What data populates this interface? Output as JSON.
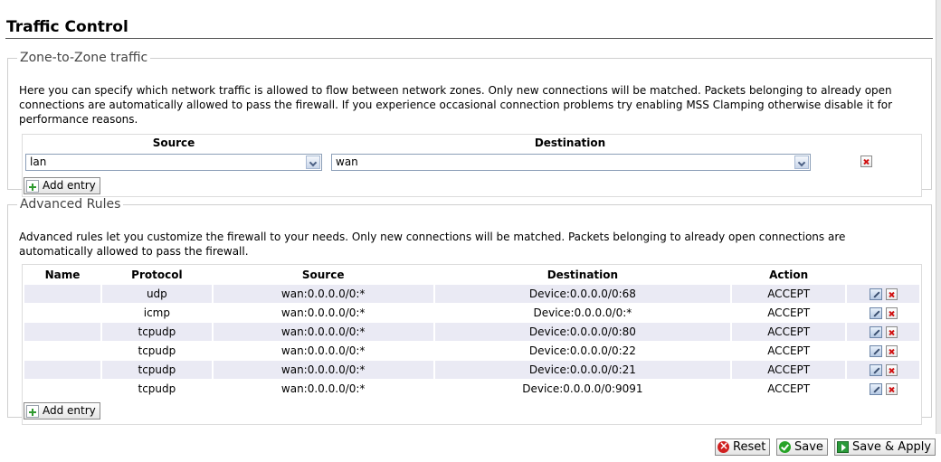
{
  "page": {
    "title": "Traffic Control"
  },
  "zone_to_zone": {
    "legend": "Zone-to-Zone traffic",
    "description": "Here you can specify which network traffic is allowed to flow between network zones. Only new connections will be matched. Packets belonging to already open connections are automatically allowed to pass the firewall. If you experience occasional connection problems try enabling MSS Clamping otherwise disable it for performance reasons.",
    "columns": {
      "source": "Source",
      "destination": "Destination"
    },
    "row": {
      "source_value": "lan",
      "destination_value": "wan"
    },
    "add_entry_label": "Add entry"
  },
  "advanced": {
    "legend": "Advanced Rules",
    "description": "Advanced rules let you customize the firewall to your needs. Only new connections will be matched. Packets belonging to already open connections are automatically allowed to pass the firewall.",
    "columns": [
      "Name",
      "Protocol",
      "Source",
      "Destination",
      "Action"
    ],
    "rows": [
      {
        "name": "",
        "protocol": "udp",
        "source": "wan:0.0.0.0/0:*",
        "destination": "Device:0.0.0.0/0:68",
        "action": "ACCEPT"
      },
      {
        "name": "",
        "protocol": "icmp",
        "source": "wan:0.0.0.0/0:*",
        "destination": "Device:0.0.0.0/0:*",
        "action": "ACCEPT"
      },
      {
        "name": "",
        "protocol": "tcpudp",
        "source": "wan:0.0.0.0/0:*",
        "destination": "Device:0.0.0.0/0:80",
        "action": "ACCEPT"
      },
      {
        "name": "",
        "protocol": "tcpudp",
        "source": "wan:0.0.0.0/0:*",
        "destination": "Device:0.0.0.0/0:22",
        "action": "ACCEPT"
      },
      {
        "name": "",
        "protocol": "tcpudp",
        "source": "wan:0.0.0.0/0:*",
        "destination": "Device:0.0.0.0/0:21",
        "action": "ACCEPT"
      },
      {
        "name": "",
        "protocol": "tcpudp",
        "source": "wan:0.0.0.0/0:*",
        "destination": "Device:0.0.0.0/0:9091",
        "action": "ACCEPT"
      }
    ],
    "add_entry_label": "Add entry"
  },
  "footer": {
    "reset_label": "Reset",
    "save_label": "Save",
    "save_apply_label": "Save & Apply"
  },
  "icons": {
    "add": "add-icon",
    "delete": "delete-icon",
    "edit": "edit-icon"
  }
}
